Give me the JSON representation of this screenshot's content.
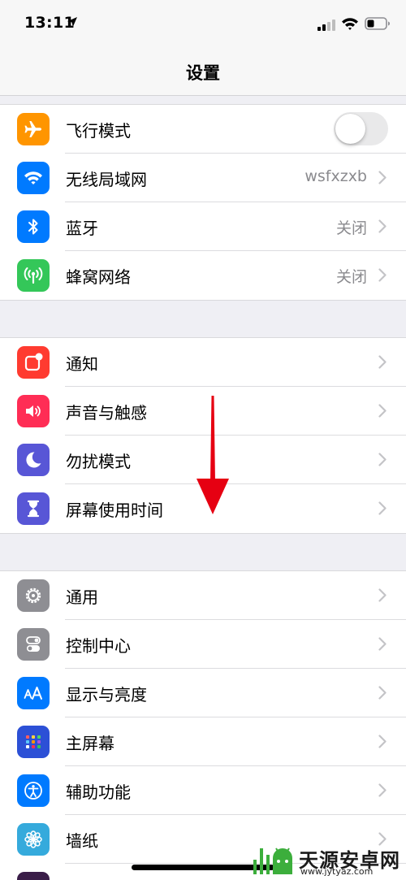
{
  "status_bar": {
    "time": "13:11"
  },
  "nav": {
    "title": "设置"
  },
  "group1": [
    {
      "label": "飞行模式",
      "icon": "airplane-icon",
      "color": "#ff9500",
      "toggle": false
    },
    {
      "label": "无线局域网",
      "icon": "wifi-icon",
      "color": "#007aff",
      "value": "wsfxzxb"
    },
    {
      "label": "蓝牙",
      "icon": "bluetooth-icon",
      "color": "#007aff",
      "value": "关闭"
    },
    {
      "label": "蜂窝网络",
      "icon": "antenna-icon",
      "color": "#34c759",
      "value": "关闭"
    }
  ],
  "group2": [
    {
      "label": "通知",
      "icon": "notification-icon",
      "color": "#ff3b30"
    },
    {
      "label": "声音与触感",
      "icon": "speaker-icon",
      "color": "#ff2d55"
    },
    {
      "label": "勿扰模式",
      "icon": "moon-icon",
      "color": "#5856d6"
    },
    {
      "label": "屏幕使用时间",
      "icon": "hourglass-icon",
      "color": "#5856d6"
    }
  ],
  "group3": [
    {
      "label": "通用",
      "icon": "gear-icon",
      "color": "#8e8e93"
    },
    {
      "label": "控制中心",
      "icon": "switches-icon",
      "color": "#8e8e93"
    },
    {
      "label": "显示与亮度",
      "icon": "text-size-icon",
      "color": "#007aff"
    },
    {
      "label": "主屏幕",
      "icon": "home-grid-icon",
      "color": "#2c50d6"
    },
    {
      "label": "辅助功能",
      "icon": "accessibility-icon",
      "color": "#007aff"
    },
    {
      "label": "墙纸",
      "icon": "flower-icon",
      "color": "#35aadc"
    }
  ],
  "watermark": {
    "name": "天源安卓网",
    "url": "www.jytyaz.com"
  }
}
